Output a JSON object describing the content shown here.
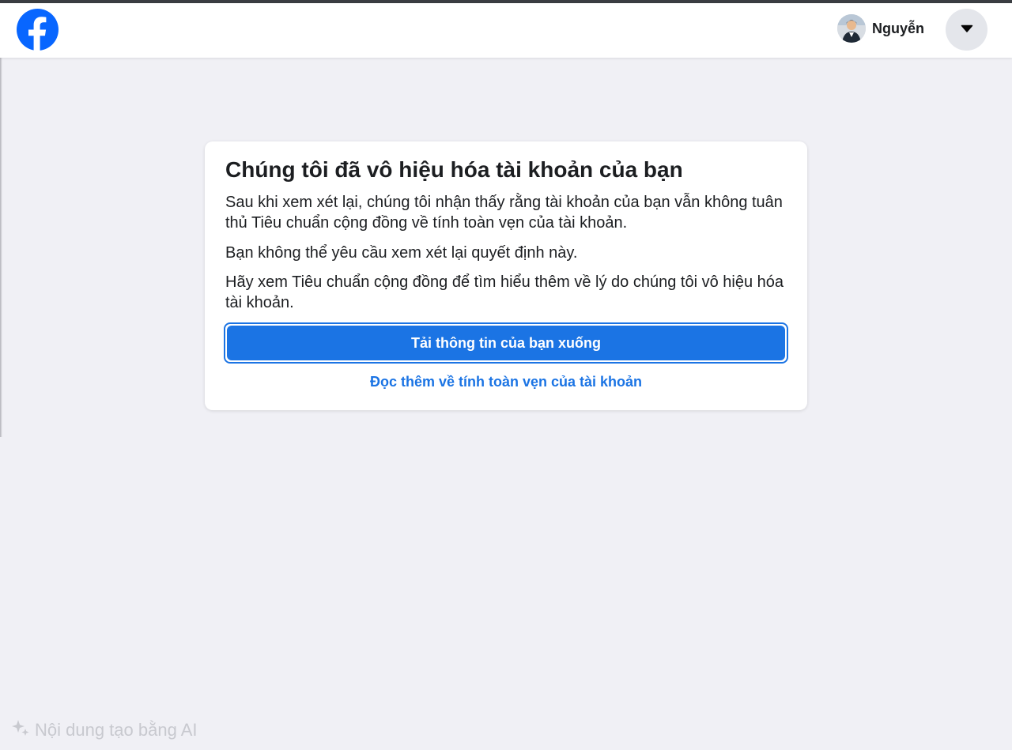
{
  "header": {
    "logo_icon": "facebook-logo-icon",
    "user_name": "Nguyễn",
    "menu_icon": "caret-down-icon"
  },
  "card": {
    "title": "Chúng tôi đã vô hiệu hóa tài khoản của bạn",
    "paragraph_1": "Sau khi xem xét lại, chúng tôi nhận thấy rằng tài khoản của bạn vẫn không tuân thủ Tiêu chuẩn cộng đồng về tính toàn vẹn của tài khoản.",
    "paragraph_2": "Bạn không thể yêu cầu xem xét lại quyết định này.",
    "paragraph_3": "Hãy xem Tiêu chuẩn cộng đồng để tìm hiểu thêm về lý do chúng tôi vô hiệu hóa tài khoản.",
    "download_button_label": "Tải thông tin của bạn xuống",
    "learn_more_link": "Đọc thêm về tính toàn vẹn của tài khoản"
  },
  "footer": {
    "ai_label": "Nội dung tạo bằng AI",
    "ai_icon": "sparkle-icon"
  },
  "colors": {
    "brand_blue": "#1b74e4",
    "page_background": "#f0f0f5"
  }
}
